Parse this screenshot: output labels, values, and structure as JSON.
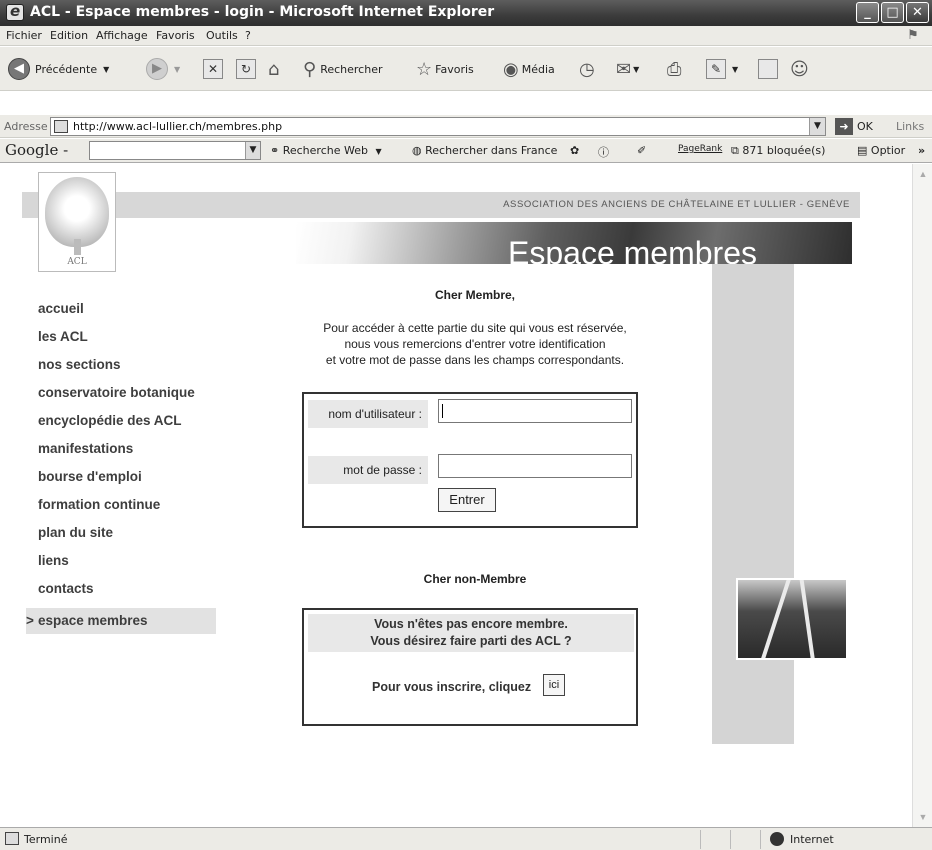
{
  "window": {
    "title": "ACL - Espace membres - login - Microsoft Internet Explorer"
  },
  "menu": [
    "Fichier",
    "Edition",
    "Affichage",
    "Favoris",
    "Outils",
    "?"
  ],
  "toolbar": {
    "back": "Précédente",
    "search": "Rechercher",
    "favorites": "Favoris",
    "media": "Média"
  },
  "address": {
    "label": "Adresse",
    "url": "http://www.acl-lullier.ch/membres.php",
    "go": "OK",
    "links": "Links"
  },
  "google": {
    "logo": "Google -",
    "search_web": "Recherche Web",
    "search_france": "Rechercher dans France",
    "pagerank": "PageRank",
    "blocked": "871 bloquée(s)",
    "options": "Optior",
    "more": "»"
  },
  "site": {
    "association": "ASSOCIATION DES ANCIENS DE CHÂTELAINE ET LULLIER - GENÈVE",
    "logo_text": "ACL",
    "banner": "Espace membres"
  },
  "nav": {
    "active_marker": ">",
    "items": [
      "accueil",
      "les ACL",
      "nos sections",
      "conservatoire botanique",
      "encyclopédie des ACL",
      "manifestations",
      "bourse d'emploi",
      "formation continue",
      "plan du site",
      "liens",
      "contacts",
      "espace membres"
    ]
  },
  "login": {
    "greeting": "Cher Membre,",
    "intro_1": "Pour accéder à cette partie du site qui vous est réservée,",
    "intro_2": "nous vous remercions d'entrer votre identification",
    "intro_3": "et votre mot de passe dans les champs correspondants.",
    "username_label": "nom d'utilisateur :",
    "password_label": "mot de passe :",
    "submit": "Entrer"
  },
  "register": {
    "greeting": "Cher non-Membre",
    "msg_1": "Vous n'êtes pas encore membre.",
    "msg_2": "Vous désirez faire parti des ACL ?",
    "cta": "Pour vous inscrire, cliquez",
    "link": "ici"
  },
  "status": {
    "text": "Terminé",
    "zone": "Internet"
  }
}
